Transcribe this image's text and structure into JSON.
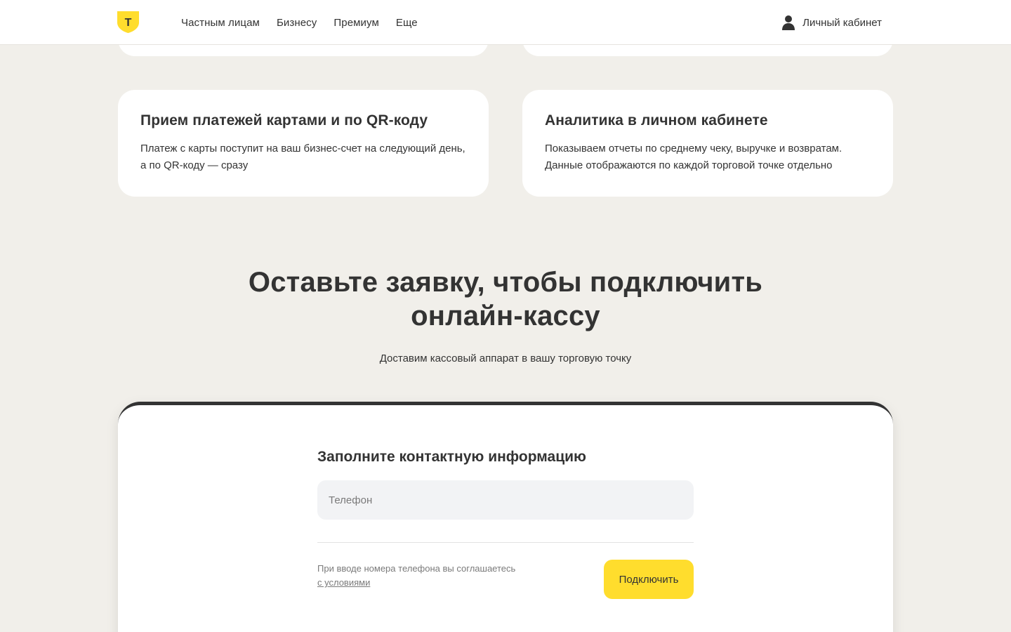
{
  "header": {
    "logo_letter": "Т",
    "nav": [
      {
        "label": "Частным лицам"
      },
      {
        "label": "Бизнесу"
      },
      {
        "label": "Премиум"
      },
      {
        "label": "Еще"
      }
    ],
    "cabinet_label": "Личный кабинет"
  },
  "features": [
    {
      "title": "Прием платежей картами и по QR-коду",
      "text_line1": "Платеж с карты поступит на ваш бизнес-счет на следующий день,",
      "text_line2": "а по QR-коду — сразу"
    },
    {
      "title": "Аналитика в личном кабинете",
      "text_line1": "Показываем отчеты по среднему чеку, выручке и возвратам.",
      "text_line2": "Данные отображаются по каждой торговой точке отдельно"
    }
  ],
  "application": {
    "title_line1": "Оставьте заявку, чтобы подключить",
    "title_line2": "онлайн-кассу",
    "subtitle": "Доставим кассовый аппарат в вашу торговую точку"
  },
  "form": {
    "title": "Заполните контактную информацию",
    "phone_placeholder": "Телефон",
    "agreement_text": "При вводе номера телефона вы соглашаетесь",
    "agreement_link": "с условиями",
    "submit_label": "Подключить"
  },
  "colors": {
    "background": "#f1efea",
    "accent": "#ffdd2d",
    "text": "#333333"
  }
}
